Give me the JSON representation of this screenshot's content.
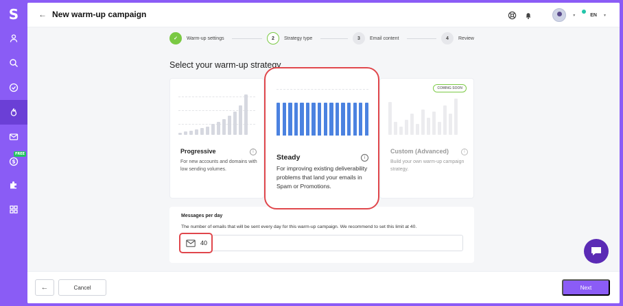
{
  "app": {
    "logo_letter": "S"
  },
  "header": {
    "title": "New warm-up campaign",
    "language": "EN"
  },
  "sidebar": {
    "free_badge": "FREE",
    "items": [
      {
        "icon": "user-icon"
      },
      {
        "icon": "search-icon"
      },
      {
        "icon": "check-circle-icon"
      },
      {
        "icon": "flame-icon",
        "active": true
      },
      {
        "icon": "mail-icon"
      },
      {
        "icon": "dollar-icon"
      },
      {
        "icon": "puzzle-icon"
      },
      {
        "icon": "grid-icon"
      }
    ]
  },
  "stepper": {
    "steps": [
      {
        "number": "✓",
        "label": "Warm-up settings",
        "state": "done"
      },
      {
        "number": "2",
        "label": "Strategy type",
        "state": "current"
      },
      {
        "number": "3",
        "label": "Email content",
        "state": "todo"
      },
      {
        "number": "4",
        "label": "Review",
        "state": "todo"
      }
    ]
  },
  "main": {
    "section_title": "Select your warm-up strategy",
    "strategies": [
      {
        "title": "Progressive",
        "description": "For new accounts and domains with low sending volumes.",
        "bar_levels": [
          0.05,
          0.08,
          0.1,
          0.13,
          0.16,
          0.2,
          0.25,
          0.3,
          0.37,
          0.45,
          0.55,
          0.7,
          0.95
        ],
        "color": "#d6d8e0"
      },
      {
        "title": "Steady",
        "description": "For improving existing deliverability problems that land your emails in Spam or Promotions.",
        "bar_levels": [
          1,
          1,
          1,
          1,
          1,
          1,
          1,
          1,
          1,
          1,
          1,
          1,
          1,
          1,
          1,
          1
        ],
        "color": "#4b82e0",
        "selected": true
      },
      {
        "title": "Custom (Advanced)",
        "description": "Build your own warm-up campaign strategy.",
        "badge": "COMING SOON",
        "bar_levels": [
          0.78,
          0.3,
          0.2,
          0.35,
          0.5,
          0.25,
          0.6,
          0.4,
          0.55,
          0.3,
          0.7,
          0.5,
          0.85
        ],
        "color": "#ececef"
      }
    ],
    "messages_per_day": {
      "label": "Messages per day",
      "help": "The number of emails that will be sent every day for this warm-up campaign. We recommend to set this limit at 40.",
      "value": "40"
    }
  },
  "footer": {
    "cancel_label": "Cancel",
    "next_label": "Next"
  },
  "colors": {
    "accent": "#8b5cf6",
    "success": "#7ac943",
    "highlight": "#e0464b",
    "bar_blue": "#4b82e0"
  }
}
